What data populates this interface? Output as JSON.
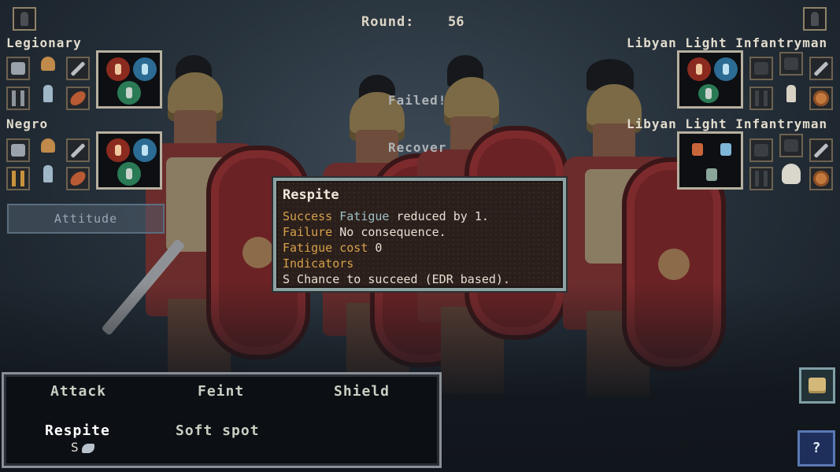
{
  "round": {
    "label": "Round:",
    "value": "56"
  },
  "left_units": [
    {
      "name": "Legionary"
    },
    {
      "name": "Negro"
    }
  ],
  "right_units": [
    {
      "name": "Libyan Light Infantryman"
    },
    {
      "name": "Libyan Light Infantryman"
    }
  ],
  "attitude_label": "Attitude",
  "floating": {
    "failed": "Failed!",
    "recover": "Recover"
  },
  "tooltip": {
    "title": "Respite",
    "lines": [
      {
        "key": "Success",
        "key2": "Fatigue",
        "text": " reduced by 1."
      },
      {
        "key": "Failure",
        "text": " No consequence."
      },
      {
        "key": "Fatigue cost",
        "text": " 0"
      },
      {
        "key": "Indicators",
        "text": ""
      },
      {
        "key": "",
        "text": "S Chance to succeed (EDR based)."
      }
    ]
  },
  "actions": [
    {
      "label": "Attack"
    },
    {
      "label": "Feint"
    },
    {
      "label": "Shield"
    },
    {
      "label": "Respite"
    },
    {
      "label": "Soft spot"
    }
  ],
  "selected_action_indicator": "S",
  "help_label": "?",
  "colors": {
    "tooltip_key": "#d8a04a",
    "tooltip_highlight": "#9dc0c6",
    "status_red": "#8b2a1f",
    "status_blue": "#2b6b94",
    "status_green": "#2a7a55"
  }
}
